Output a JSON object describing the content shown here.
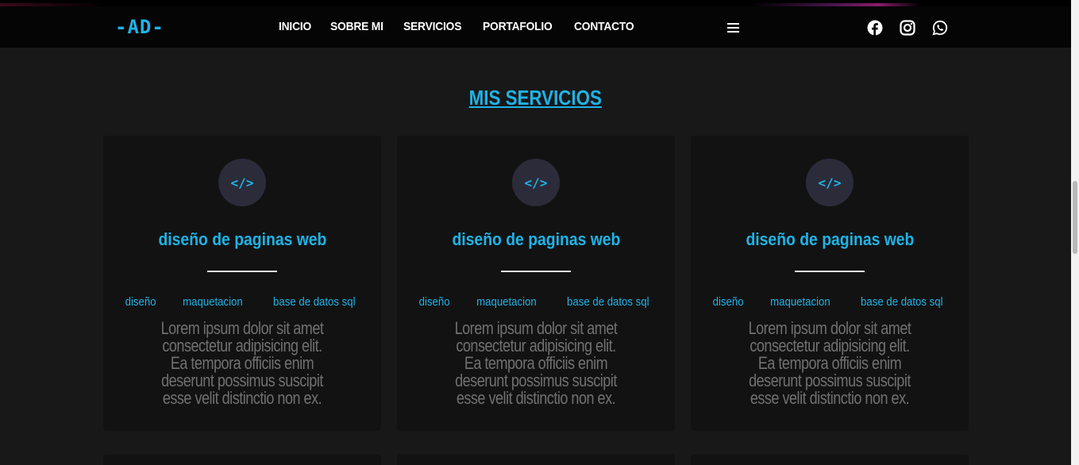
{
  "nav": {
    "logo": "-AD-",
    "menu": [
      "INICIO",
      "SOBRE MI",
      "SERVICIOS",
      "PORTAFOLIO",
      "CONTACTO"
    ],
    "social": [
      "facebook-icon",
      "instagram-icon",
      "whatsapp-icon"
    ]
  },
  "section": {
    "title": "MIS SERVICIOS"
  },
  "cards": [
    {
      "icon": "</>",
      "title": "diseño de paginas web",
      "tags": [
        "diseño",
        "maquetacion",
        "base de datos sql"
      ],
      "description": "Lorem ipsum dolor sit amet consectetur adipisicing elit. Ea tempora officiis enim deserunt possimus suscipit esse velit distinctio non ex."
    },
    {
      "icon": "</>",
      "title": "diseño de paginas web",
      "tags": [
        "diseño",
        "maquetacion",
        "base de datos sql"
      ],
      "description": "Lorem ipsum dolor sit amet consectetur adipisicing elit. Ea tempora officiis enim deserunt possimus suscipit esse velit distinctio non ex."
    },
    {
      "icon": "</>",
      "title": "diseño de paginas web",
      "tags": [
        "diseño",
        "maquetacion",
        "base de datos sql"
      ],
      "description": "Lorem ipsum dolor sit amet consectetur adipisicing elit. Ea tempora officiis enim deserunt possimus suscipit esse velit distinctio non ex."
    }
  ],
  "colors": {
    "accent": "#1fb3e6",
    "background": "#181818",
    "card": "#121212",
    "navbar": "#050505"
  }
}
